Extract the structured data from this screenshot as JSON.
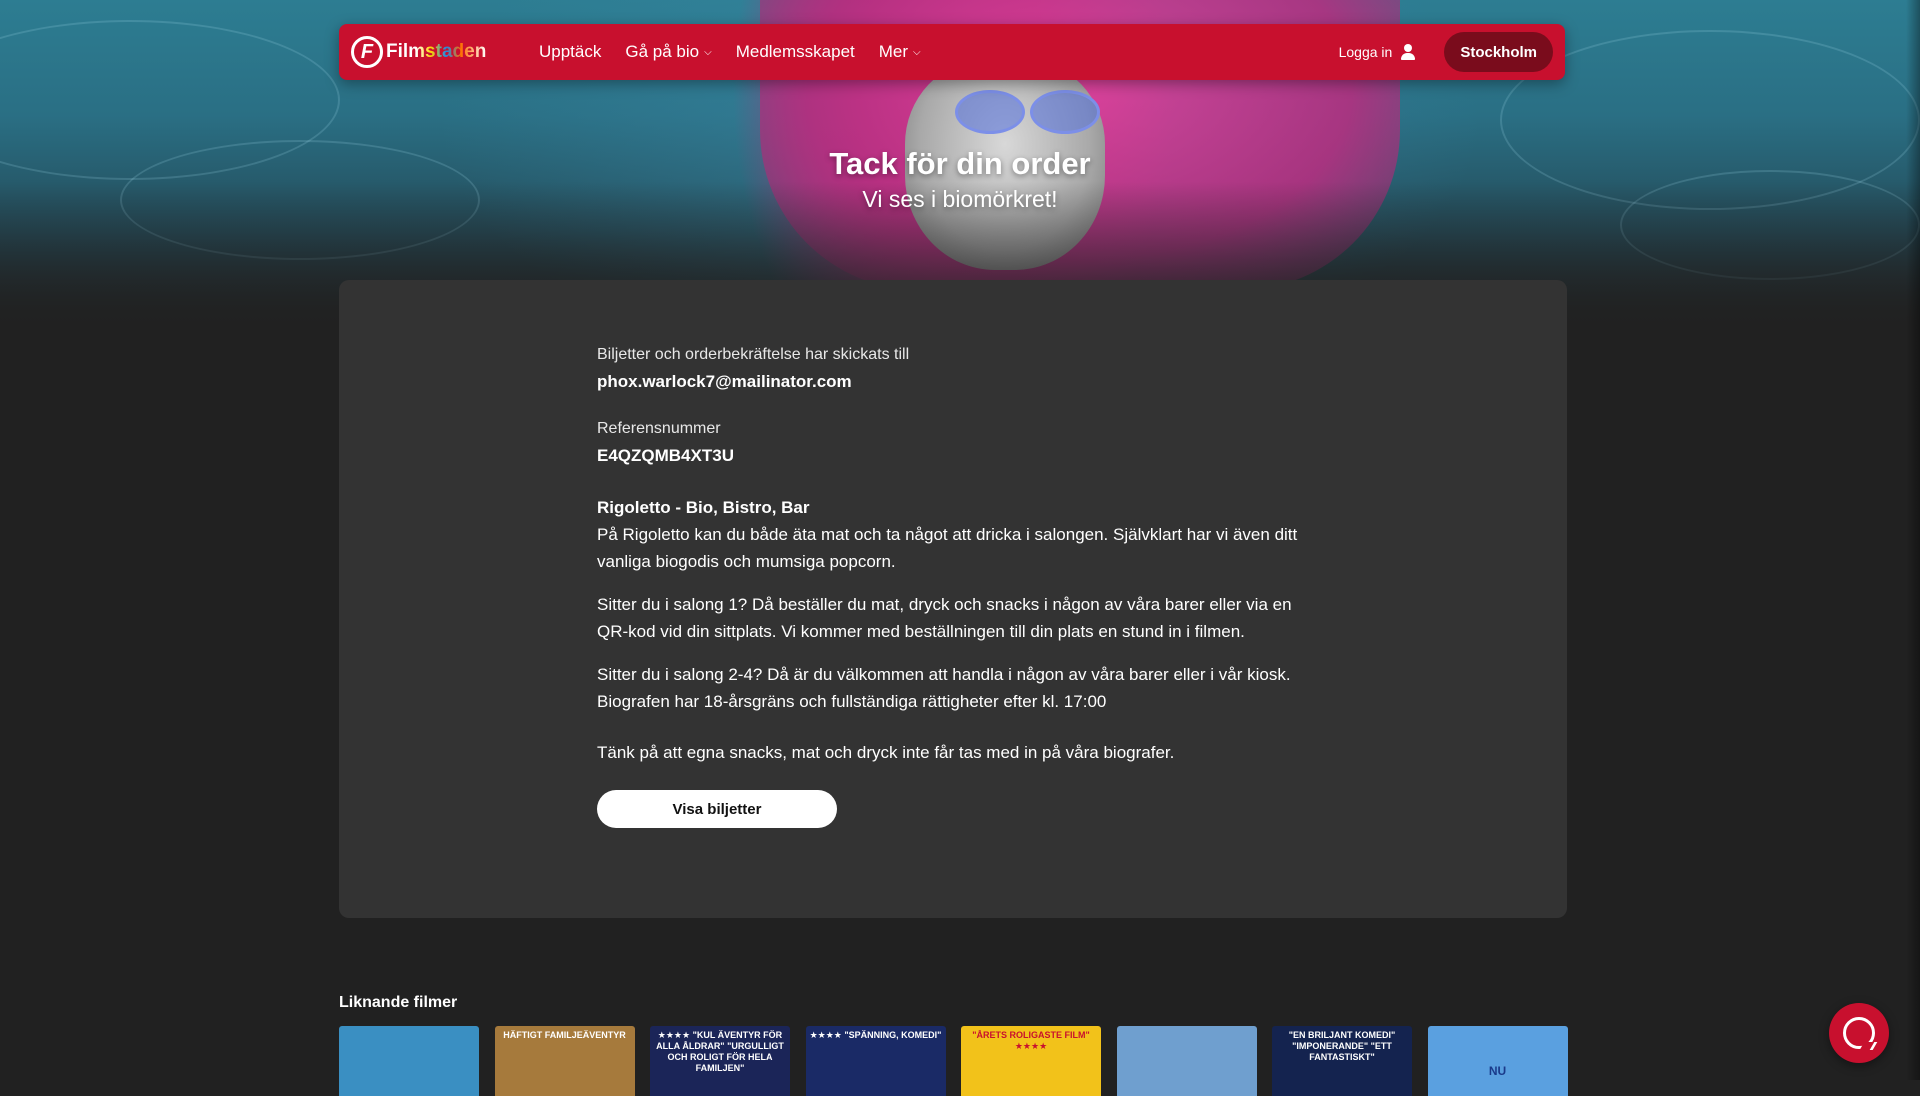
{
  "nav": {
    "logo_text": "Filmstaden",
    "links": [
      {
        "label": "Upptäck",
        "dropdown": false
      },
      {
        "label": "Gå på bio",
        "dropdown": true
      },
      {
        "label": "Medlemsskapet",
        "dropdown": false
      },
      {
        "label": "Mer",
        "dropdown": true
      }
    ],
    "login_label": "Logga in",
    "city_label": "Stockholm"
  },
  "hero": {
    "title": "Tack för din order",
    "subtitle": "Vi ses i biomörkret!"
  },
  "order": {
    "sent_to_label": "Biljetter och orderbekräftelse har skickats till",
    "email": "phox.warlock7@mailinator.com",
    "reference_label": "Referensnummer",
    "reference": "E4QZQMB4XT3U",
    "venue_title": "Rigoletto - Bio, Bistro, Bar",
    "venue_text": "På Rigoletto kan du både äta mat och ta något att dricka i salongen. Självklart har vi även ditt vanliga biogodis och mumsiga popcorn.",
    "salong1_text": "Sitter du i salong 1? Då beställer du mat, dryck och snacks i någon av våra barer eller via en QR-kod vid din sittplats. Vi kommer med beställningen till din plats en stund in i filmen.",
    "salong2_text": "Sitter du i salong 2-4? Då är du välkommen att handla i någon av våra barer eller i vår kiosk.",
    "age_text": "Biografen har 18-årsgräns och fullständiga rättigheter efter kl. 17:00",
    "snacks_text": "Tänk på att egna snacks, mat och dryck inte får tas med in på våra biografer.",
    "show_tickets_label": "Visa biljetter"
  },
  "similar": {
    "title": "Liknande filmer",
    "posters": [
      {
        "caption": "",
        "bg": "#3a8fc2"
      },
      {
        "caption": "HÄFTIGT FAMILJEÄVENTYR",
        "bg": "#a67a3c"
      },
      {
        "caption": "★★★★ \"KUL ÄVENTYR FÖR ALLA ÅLDRAR\" \"URGULLIGT OCH ROLIGT FÖR HELA FAMILJEN\"",
        "bg": "#1b2558"
      },
      {
        "caption": "★★★★ \"SPÄNNING, KOMEDI\"",
        "bg": "#1a2a66"
      },
      {
        "caption": "\"ÅRETS ROLIGASTE FILM\" ★★★★",
        "bg": "#f2c21a"
      },
      {
        "caption": "",
        "bg": "#6f9fcf"
      },
      {
        "caption": "\"EN BRILJANT KOMEDI\" \"IMPONERANDE\" \"ETT FANTASTISKT\"",
        "bg": "#14234f"
      },
      {
        "caption": "NU",
        "bg": "#5aa0e0"
      }
    ]
  },
  "colors": {
    "brand_red": "#c8102e",
    "card_bg": "#333333",
    "page_bg": "#212121"
  },
  "icons": {
    "user": "user-icon",
    "chevron": "chevron-down-icon",
    "chat": "chat-icon"
  }
}
